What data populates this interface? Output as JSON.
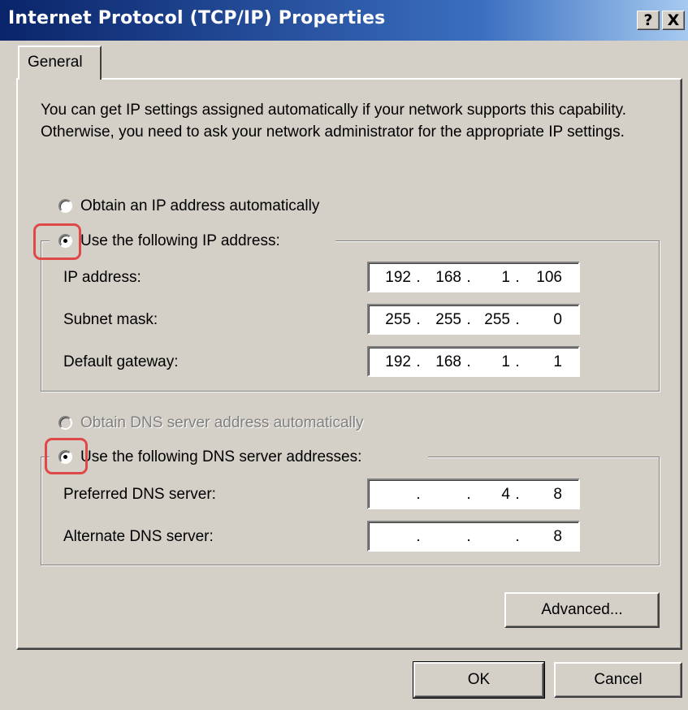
{
  "window": {
    "title": "Internet Protocol (TCP/IP) Properties",
    "help_label": "?",
    "close_label": "X"
  },
  "tabs": [
    {
      "label": "General",
      "active": true
    }
  ],
  "description": "You can get IP settings assigned automatically if your network supports this capability. Otherwise, you need to ask your network administrator for the appropriate IP settings.",
  "ip_mode": {
    "auto_label": "Obtain an IP address automatically",
    "manual_label": "Use the following IP address:",
    "selected": "manual"
  },
  "ip_fields": [
    {
      "label": "IP address:",
      "octets": [
        "192",
        "168",
        "1",
        "106"
      ]
    },
    {
      "label": "Subnet mask:",
      "octets": [
        "255",
        "255",
        "255",
        "0"
      ]
    },
    {
      "label": "Default gateway:",
      "octets": [
        "192",
        "168",
        "1",
        "1"
      ]
    }
  ],
  "dns_mode": {
    "auto_label": "Obtain DNS server address automatically",
    "manual_label": "Use the following DNS server addresses:",
    "selected": "manual",
    "auto_disabled": true
  },
  "dns_fields": [
    {
      "label": "Preferred DNS server:",
      "octets": [
        "",
        "",
        "4",
        "8"
      ]
    },
    {
      "label": "Alternate DNS server:",
      "octets": [
        "",
        "",
        "",
        "8"
      ]
    }
  ],
  "buttons": {
    "advanced": "Advanced...",
    "ok": "OK",
    "cancel": "Cancel"
  },
  "annotation": {
    "highlight_color": "#e04848"
  },
  "colors": {
    "dialog_bg": "#d4d0c8",
    "titlebar_start": "#0a246a",
    "titlebar_end": "#a6caf0"
  }
}
